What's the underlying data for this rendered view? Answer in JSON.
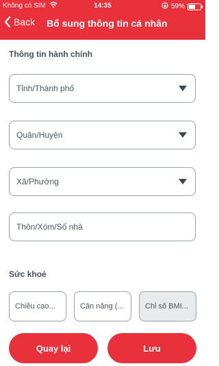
{
  "status_bar": {
    "carrier": "Không có SIM",
    "time": "14:35",
    "battery": "59%",
    "battery_level": 0.59
  },
  "header": {
    "back_label": "Back",
    "title": "Bổ sung thông tin cá nhân"
  },
  "admin_section": {
    "label": "Thông tin hành chính",
    "fields": [
      {
        "placeholder": "Tỉnh/Thành phố",
        "type": "dropdown"
      },
      {
        "placeholder": "Quận/Huyện",
        "type": "dropdown"
      },
      {
        "placeholder": "Xã/Phường",
        "type": "dropdown"
      },
      {
        "placeholder": "Thôn/Xóm/Số nhà",
        "type": "text"
      }
    ]
  },
  "health_section": {
    "label": "Sức khoẻ",
    "fields": [
      {
        "placeholder": "Chiều cao..."
      },
      {
        "placeholder": "Cân nặng (..."
      },
      {
        "placeholder": "Chỉ số BMI..."
      }
    ]
  },
  "footer": {
    "back_button": "Quay lại",
    "save_button": "Lưu"
  },
  "colors": {
    "brand": "#e8313b"
  }
}
